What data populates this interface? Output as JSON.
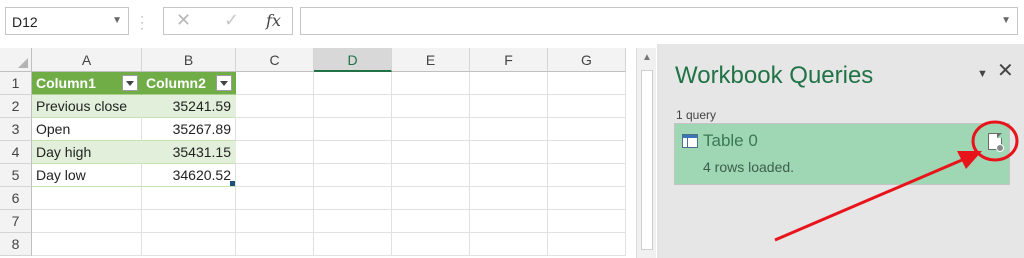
{
  "formula_bar": {
    "name_box": "D12",
    "fx_label": "fx",
    "cancel_glyph": "✕",
    "enter_glyph": "✓",
    "formula": ""
  },
  "sheet": {
    "columns": [
      "A",
      "B",
      "C",
      "D",
      "E",
      "F",
      "G"
    ],
    "selected_column": "D",
    "rows": [
      "1",
      "2",
      "3",
      "4",
      "5",
      "6",
      "7",
      "8"
    ],
    "table_headers": [
      "Column1",
      "Column2"
    ],
    "table_rows": [
      {
        "label": "Previous close",
        "value": "35241.59"
      },
      {
        "label": "Open",
        "value": "35267.89"
      },
      {
        "label": "Day high",
        "value": "35431.15"
      },
      {
        "label": "Day low",
        "value": "34620.52"
      }
    ],
    "colors": {
      "table_header": "#70ad47",
      "band": "#e2efda",
      "accent": "#217346"
    }
  },
  "queries_pane": {
    "title": "Workbook Queries",
    "count_label": "1 query",
    "query": {
      "name": "Table 0",
      "status": "4 rows loaded."
    },
    "icons": [
      "table-icon",
      "query-options-icon",
      "pane-dropdown-icon",
      "close-icon"
    ],
    "colors": {
      "card": "#9fd6b4",
      "title": "#217346"
    }
  },
  "annotation": {
    "color": "#e8141b",
    "shapes": [
      "circle",
      "arrow"
    ]
  }
}
